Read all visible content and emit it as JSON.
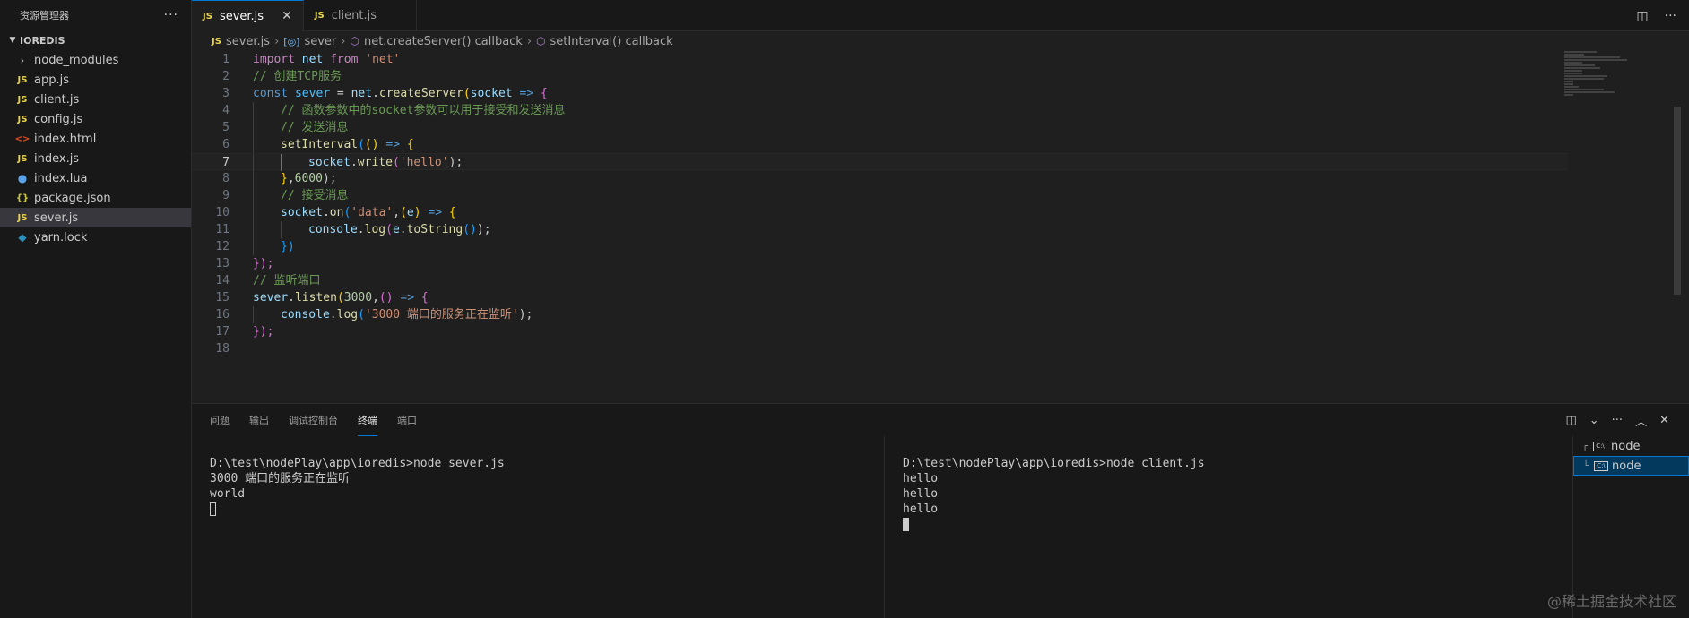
{
  "sidebar": {
    "title": "资源管理器",
    "more": "···",
    "section": "IOREDIS",
    "items": [
      {
        "label": "node_modules",
        "icon": "›",
        "type": "folder"
      },
      {
        "label": "app.js",
        "icon": "JS",
        "type": "js"
      },
      {
        "label": "client.js",
        "icon": "JS",
        "type": "js"
      },
      {
        "label": "config.js",
        "icon": "JS",
        "type": "js"
      },
      {
        "label": "index.html",
        "icon": "<>",
        "type": "html"
      },
      {
        "label": "index.js",
        "icon": "JS",
        "type": "js"
      },
      {
        "label": "index.lua",
        "icon": "●",
        "type": "lua"
      },
      {
        "label": "package.json",
        "icon": "{}",
        "type": "json"
      },
      {
        "label": "sever.js",
        "icon": "JS",
        "type": "js",
        "selected": true
      },
      {
        "label": "yarn.lock",
        "icon": "◆",
        "type": "yarn"
      }
    ]
  },
  "tabs": [
    {
      "label": "sever.js",
      "icon": "JS",
      "active": true
    },
    {
      "label": "client.js",
      "icon": "JS",
      "active": false
    }
  ],
  "breadcrumb": {
    "file_icon": "JS",
    "file": "sever.js",
    "var_icon": "[◎]",
    "var": "sever",
    "fn1_icon": "⬡",
    "fn1": "net.createServer() callback",
    "fn2_icon": "⬡",
    "fn2": "setInterval() callback"
  },
  "editor": {
    "current_line": 7,
    "line_numbers": [
      "1",
      "2",
      "3",
      "4",
      "5",
      "6",
      "7",
      "8",
      "9",
      "10",
      "11",
      "12",
      "13",
      "14",
      "15",
      "16",
      "17",
      "18"
    ],
    "tokens": {
      "l1": [
        "import",
        " ",
        "net",
        " ",
        "from",
        " ",
        "'net'"
      ],
      "l2": [
        "// 创建TCP服务"
      ],
      "l3": [
        "const",
        " ",
        "sever",
        " = ",
        "net",
        ".",
        "createServer",
        "(",
        "socket",
        " ",
        "=>",
        " ",
        "{"
      ],
      "l4": [
        "// 函数参数中的socket参数可以用于接受和发送消息"
      ],
      "l5": [
        "// 发送消息"
      ],
      "l6": [
        "setInterval",
        "(",
        "()",
        " ",
        "=>",
        " ",
        "{"
      ],
      "l7": [
        "socket",
        ".",
        "write",
        "(",
        "'hello'",
        ");"
      ],
      "l8": [
        "}",
        ",",
        "6000",
        ");"
      ],
      "l9": [
        "// 接受消息"
      ],
      "l10": [
        "socket",
        ".",
        "on",
        "(",
        "'data'",
        ",",
        "(",
        "e",
        ")",
        " ",
        "=>",
        " ",
        "{"
      ],
      "l11": [
        "console",
        ".",
        "log",
        "(",
        "e",
        ".",
        "toString",
        "()",
        ");"
      ],
      "l12": [
        "})"
      ],
      "l13": [
        "});"
      ],
      "l14": [
        "// 监听端口"
      ],
      "l15": [
        "sever",
        ".",
        "listen",
        "(",
        "3000",
        ",",
        "()",
        " ",
        "=>",
        " ",
        "{"
      ],
      "l16": [
        "console",
        ".",
        "log",
        "(",
        "'3000 端口的服务正在监听'",
        ");"
      ],
      "l17": [
        "});"
      ]
    }
  },
  "panel": {
    "tabs": [
      "问题",
      "输出",
      "调试控制台",
      "终端",
      "端口"
    ],
    "active_tab": "终端",
    "terminal_left": [
      "D:\\test\\nodePlay\\app\\ioredis>node sever.js",
      "3000 端口的服务正在监听",
      "world"
    ],
    "terminal_right": [
      "D:\\test\\nodePlay\\app\\ioredis>node client.js",
      "hello",
      "hello",
      "hello"
    ],
    "terminal_list": [
      {
        "label": "node",
        "glyph": "┌",
        "icon": "C:\\"
      },
      {
        "label": "node",
        "glyph": "└",
        "icon": "C:\\",
        "selected": true
      }
    ]
  },
  "watermark": "@稀土掘金技术社区"
}
